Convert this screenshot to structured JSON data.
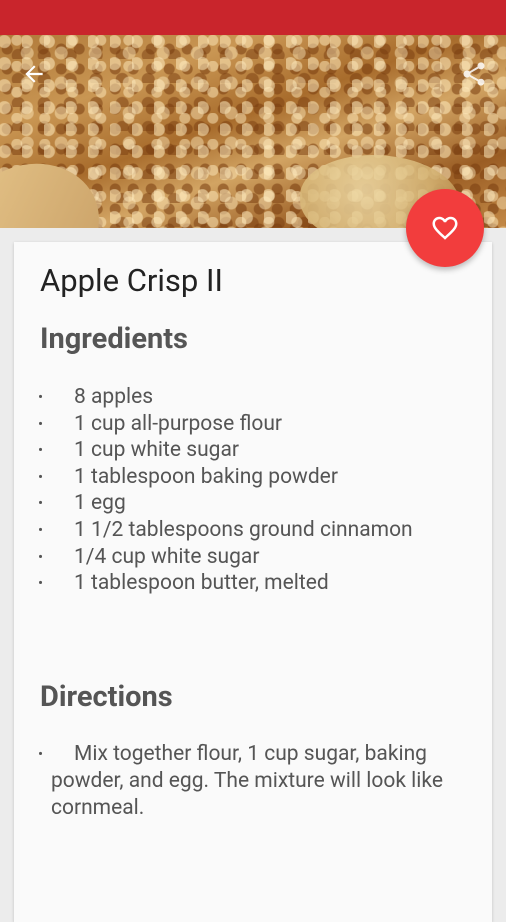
{
  "app": {
    "accent_color": "#c9252c",
    "fab_color": "#f23d3d"
  },
  "toolbar": {
    "back_icon": "arrow-back-icon",
    "share_icon": "share-icon"
  },
  "favorite": {
    "icon": "heart-outline-icon"
  },
  "recipe": {
    "title": "Apple Crisp II",
    "ingredients_heading": "Ingredients",
    "ingredients": [
      "8 apples",
      "1 cup all-purpose flour",
      "1 cup white sugar",
      "1 tablespoon baking powder",
      "1 egg",
      "1 1/2 tablespoons ground cinnamon",
      "1/4 cup white sugar",
      "1 tablespoon butter, melted"
    ],
    "directions_heading": "Directions",
    "directions": [
      "Mix together flour, 1 cup sugar, baking powder, and egg. The mixture will look like cornmeal."
    ]
  }
}
